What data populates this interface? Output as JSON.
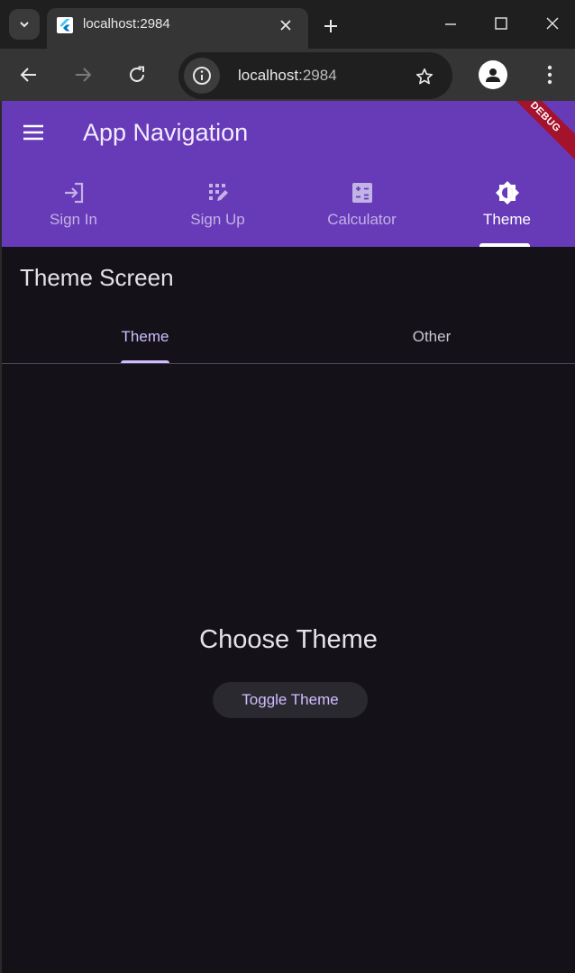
{
  "browser": {
    "tab_title": "localhost:2984",
    "url_host": "localhost",
    "url_port": ":2984"
  },
  "app": {
    "title": "App Navigation",
    "debug_banner": "DEBUG",
    "accent_color": "#673ab7",
    "nav_tabs": [
      {
        "label": "Sign In",
        "icon": "login-icon"
      },
      {
        "label": "Sign Up",
        "icon": "app-registration-icon"
      },
      {
        "label": "Calculator",
        "icon": "calculate-icon"
      },
      {
        "label": "Theme",
        "icon": "brightness-icon",
        "selected": true
      }
    ],
    "screen_title": "Theme Screen",
    "sub_tabs": [
      {
        "label": "Theme",
        "selected": true
      },
      {
        "label": "Other"
      }
    ],
    "heading": "Choose Theme",
    "toggle_button": "Toggle Theme"
  }
}
